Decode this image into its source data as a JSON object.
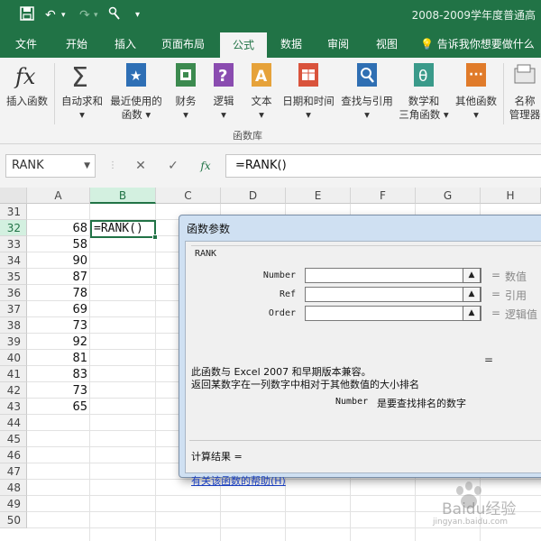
{
  "title": "2008-2009学年度普通高",
  "quick_access": {
    "save_icon": "save-icon",
    "undo_icon": "undo-icon",
    "redo_icon": "redo-icon",
    "touch_icon": "touch-mode-icon",
    "customize_icon": "customize-icon"
  },
  "tabs": [
    "文件",
    "开始",
    "插入",
    "页面布局",
    "公式",
    "数据",
    "审阅",
    "视图"
  ],
  "active_tab": "公式",
  "tell_me": "告诉我你想要做什么",
  "ribbon": {
    "group_label": "函数库",
    "buttons": [
      {
        "line1": "插入函数",
        "line2": ""
      },
      {
        "line1": "自动求和",
        "line2": "▾"
      },
      {
        "line1": "最近使用的",
        "line2": "函数 ▾"
      },
      {
        "line1": "财务",
        "line2": "▾"
      },
      {
        "line1": "逻辑",
        "line2": "▾"
      },
      {
        "line1": "文本",
        "line2": "▾"
      },
      {
        "line1": "日期和时间",
        "line2": "▾"
      },
      {
        "line1": "查找与引用",
        "line2": "▾"
      },
      {
        "line1": "数学和",
        "line2": "三角函数 ▾"
      },
      {
        "line1": "其他函数",
        "line2": "▾"
      },
      {
        "line1": "名称",
        "line2": "管理器"
      }
    ]
  },
  "formula_bar": {
    "name_box": "RANK",
    "formula": "=RANK()",
    "cancel": "✕",
    "enter": "✓",
    "fx": "fx"
  },
  "columns": [
    "A",
    "B",
    "C",
    "D",
    "E",
    "F",
    "G",
    "H"
  ],
  "rows": [
    {
      "num": "31",
      "a": ""
    },
    {
      "num": "32",
      "a": "68"
    },
    {
      "num": "33",
      "a": "58"
    },
    {
      "num": "34",
      "a": "90"
    },
    {
      "num": "35",
      "a": "87"
    },
    {
      "num": "36",
      "a": "78"
    },
    {
      "num": "37",
      "a": "69"
    },
    {
      "num": "38",
      "a": "73"
    },
    {
      "num": "39",
      "a": "92"
    },
    {
      "num": "40",
      "a": "81"
    },
    {
      "num": "41",
      "a": "83"
    },
    {
      "num": "42",
      "a": "73"
    },
    {
      "num": "43",
      "a": "65"
    },
    {
      "num": "44",
      "a": ""
    },
    {
      "num": "45",
      "a": ""
    },
    {
      "num": "46",
      "a": ""
    },
    {
      "num": "47",
      "a": ""
    },
    {
      "num": "48",
      "a": ""
    },
    {
      "num": "49",
      "a": ""
    },
    {
      "num": "50",
      "a": ""
    }
  ],
  "active_cell_text": "=RANK()",
  "dialog": {
    "title": "函数参数",
    "function_name": "RANK",
    "args": [
      {
        "label": "Number",
        "hint": "数值"
      },
      {
        "label": "Ref",
        "hint": "引用"
      },
      {
        "label": "Order",
        "hint": "逻辑值"
      }
    ],
    "result_eq": "=",
    "desc1": "此函数与 Excel 2007 和早期版本兼容。",
    "desc2": "返回某数字在一列数字中相对于其他数值的大小排名",
    "arg_desc_name": "Number",
    "arg_desc_text": "是要查找排名的数字",
    "calc_result": "计算结果 =",
    "help_link": "有关该函数的帮助(H)"
  },
  "watermark": {
    "text": "Baidu经验",
    "url": "jingyan.baidu.com"
  },
  "colors": {
    "excel_green": "#217346",
    "ribbon_bg": "#f3f3f3",
    "dialog_frame": "#cfe0f2"
  }
}
